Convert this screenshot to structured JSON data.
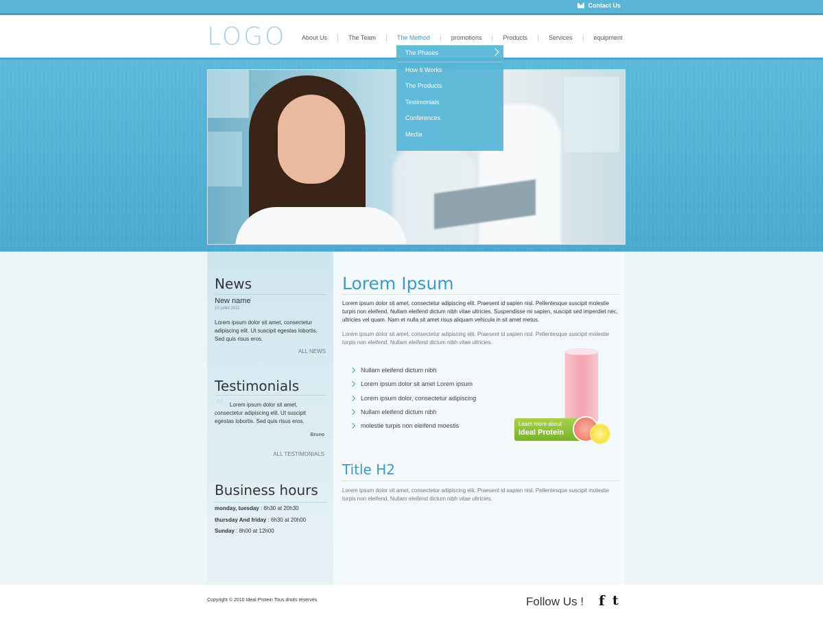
{
  "topbar": {
    "contact_label": "Contact Us"
  },
  "header": {
    "logo": "LOGO",
    "nav": [
      "About Us",
      "The Team",
      "The Method",
      "promotions",
      "Products",
      "Services",
      "equipment"
    ],
    "active_nav": "The Method"
  },
  "dropdown": {
    "items": [
      "The Phases",
      "How It Works",
      "The Products",
      "Testimonials",
      "Conferences",
      "Media"
    ]
  },
  "sidebar": {
    "news": {
      "heading": "News",
      "item_title": "New name",
      "item_date": "15 juillet 2011",
      "item_text": "Lorem ipsum dolor sit amet, consectetur adipiscing elit. Ut suscipit egestas lobortis. Sed quis risus eros.",
      "link": "ALL NEWS"
    },
    "testimonials": {
      "heading": "Testimonials",
      "quote": "Lorem ipsum dolor sit amet, consectetur adipiscing elit. Ut suscipit egestas lobortis. Sed quis risus eros.",
      "author": "Bruno",
      "link": "ALL TESTIMONIALS"
    },
    "hours": {
      "heading": "Business hours",
      "rows": [
        {
          "days": "monday, tuesday",
          "time": " : 6h30 at 20h30"
        },
        {
          "days": "thursday And friday",
          "time": " : 6h30 at 20h00"
        },
        {
          "days": "Sunday",
          "time": " : 8h00 at 12h00"
        }
      ]
    }
  },
  "main": {
    "title": "Lorem Ipsum",
    "intro": "Lorem ipsum dolor sit amet, consectetur adipiscing elit. Praesent id sapien nisl. Pellentesque suscipit molestie turpis non eleifend. Nullam eleifend dictum nibh vitae ultricies. Suspendisse mi sapien, suscipit sed imperdiet nec, ultricies vel quam. Nam et nulla sit amet risus aliquam vehicula in sit amet metus.",
    "para2": "Lorem ipsum dolor sit amet, consectetur adipiscing elit. Praesent id sapien nisl. Pellentesque suscipit molestie turpis non eleifend. Nullam eleifend dictum nibh vitae ultricies.",
    "bullets": [
      "Nullam eleifend dictum nibh",
      "Lorem ipsum dolor sit amet Lorem ipsum",
      "Lorem ipsum dolor, consectetur adipiscing",
      "Nullam eleifend dictum nibh",
      "molestie turpis non eleifend moestis"
    ],
    "promo": {
      "line1": "Learn more about",
      "line2": "Ideal Protein"
    },
    "h2": "Title H2",
    "para3": "Lorem ipsum dolor sit amet, consectetur adipiscing elit. Praesent id sapien nisl. Pellentesque suscipit molestie turpis non eleifend. Nullam eleifend dictum nibh vitae ultricies."
  },
  "footer": {
    "copyright": "Copyright © 2010 Ideal Protein Tous droits réservés",
    "follow": "Follow Us !",
    "facebook": "f",
    "twitter": "t"
  },
  "colors": {
    "accent": "#3a9cc6",
    "banner": "#4aa9cf",
    "promo_green": "#8cc63f"
  }
}
